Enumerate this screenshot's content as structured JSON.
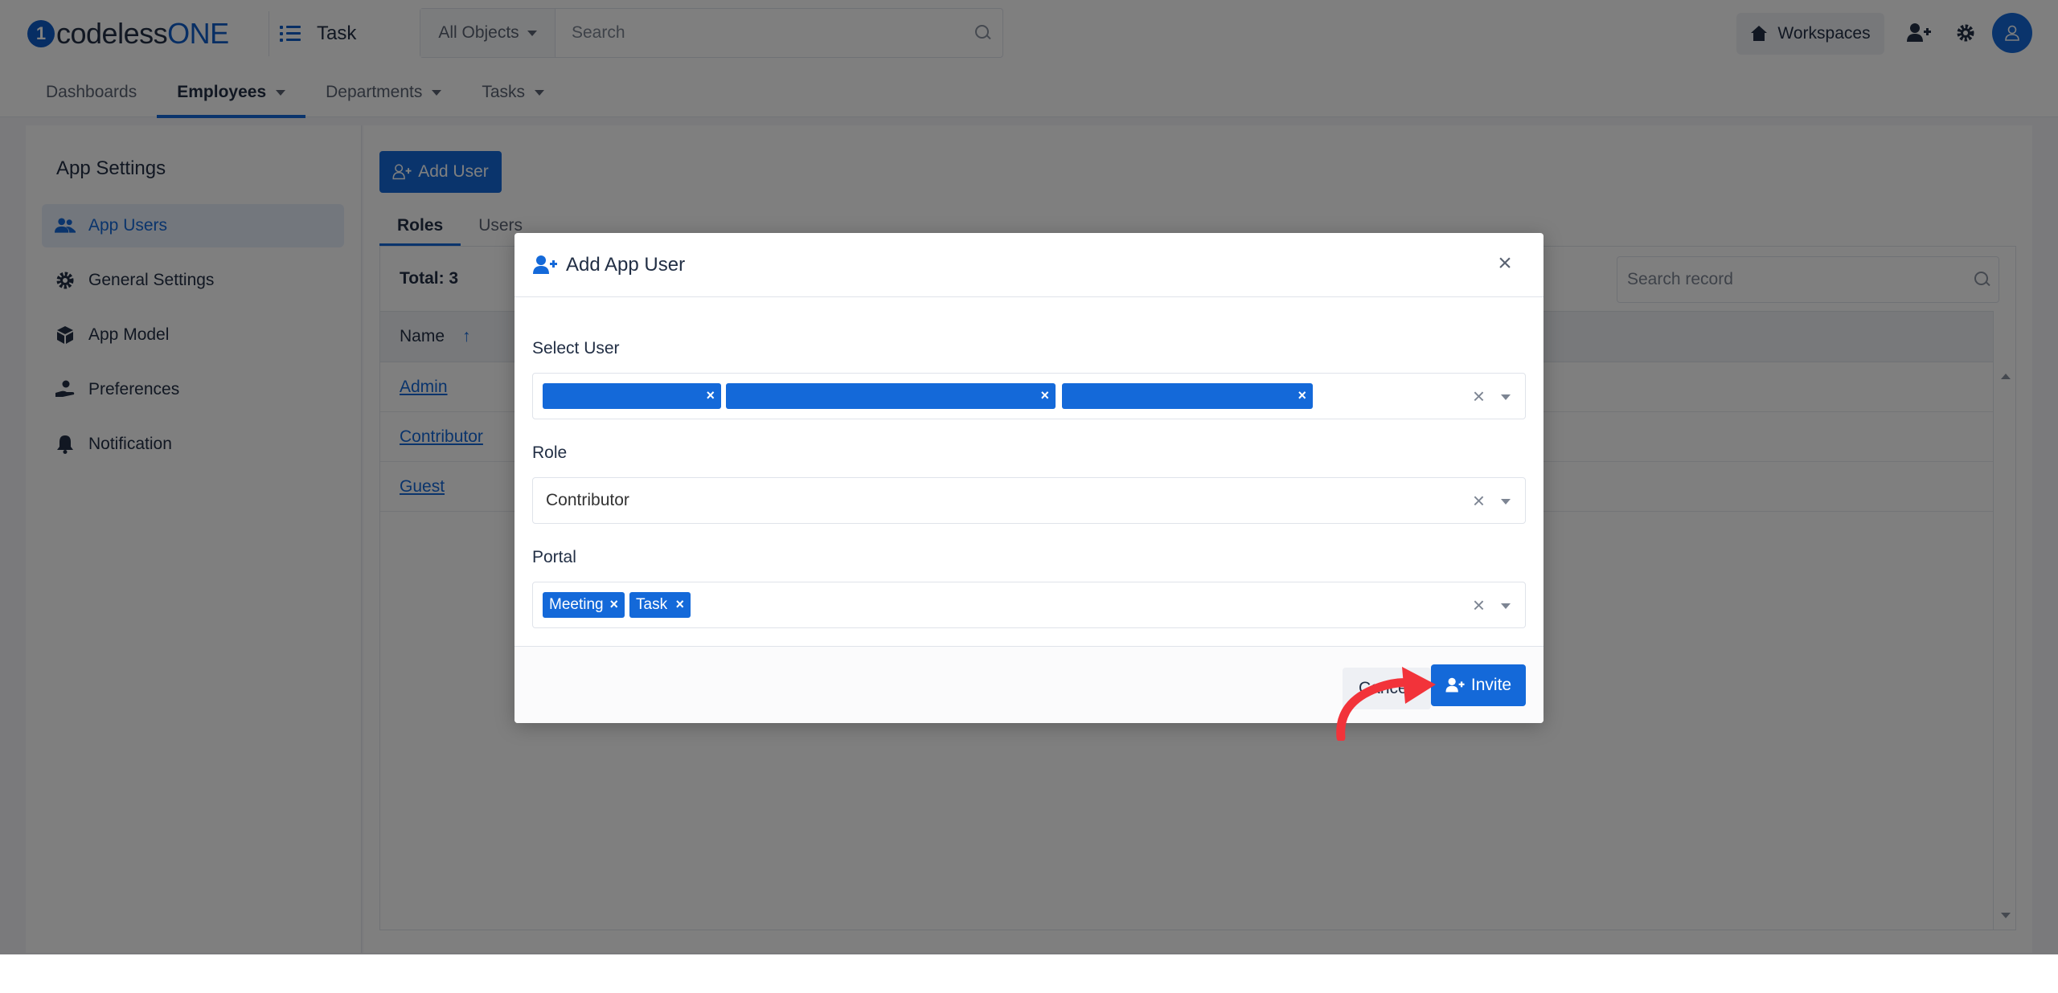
{
  "brand": {
    "logo_part1": "codeless",
    "logo_part2": "ONE"
  },
  "app": {
    "name": "Task"
  },
  "search": {
    "object_filter": "All Objects",
    "placeholder": "Search"
  },
  "header": {
    "workspaces_label": "Workspaces"
  },
  "nav": {
    "items": [
      {
        "label": "Dashboards",
        "dropdown": false,
        "active": false
      },
      {
        "label": "Employees",
        "dropdown": true,
        "active": true
      },
      {
        "label": "Departments",
        "dropdown": true,
        "active": false
      },
      {
        "label": "Tasks",
        "dropdown": true,
        "active": false
      }
    ]
  },
  "sidebar": {
    "title": "App Settings",
    "items": [
      {
        "label": "App Users",
        "icon": "users-icon",
        "active": true
      },
      {
        "label": "General Settings",
        "icon": "gear-icon",
        "active": false
      },
      {
        "label": "App Model",
        "icon": "cube-icon",
        "active": false
      },
      {
        "label": "Preferences",
        "icon": "hand-user-icon",
        "active": false
      },
      {
        "label": "Notification",
        "icon": "bell-icon",
        "active": false
      }
    ]
  },
  "main": {
    "add_user_label": "Add User",
    "tabs": [
      {
        "label": "Roles",
        "active": true
      },
      {
        "label": "Users",
        "active": false
      }
    ],
    "total_label": "Total: 3",
    "search_placeholder": "Search record",
    "column_name": "Name",
    "sort_indicator": "↑",
    "rows": [
      {
        "name": "Admin"
      },
      {
        "name": "Contributor"
      },
      {
        "name": "Guest"
      }
    ]
  },
  "modal": {
    "title": "Add App User",
    "close_symbol": "×",
    "select_user_label": "Select User",
    "selected_users": [
      "",
      "",
      ""
    ],
    "role_label": "Role",
    "role_value": "Contributor",
    "portal_label": "Portal",
    "portals": [
      "Meeting",
      "Task"
    ],
    "tag_remove_symbol": "×",
    "clear_symbol": "×",
    "cancel_label": "Cancel",
    "invite_label": "Invite"
  },
  "colors": {
    "primary": "#1469d9",
    "brand_dark": "#222f45",
    "annotation_arrow": "#f2333a"
  }
}
